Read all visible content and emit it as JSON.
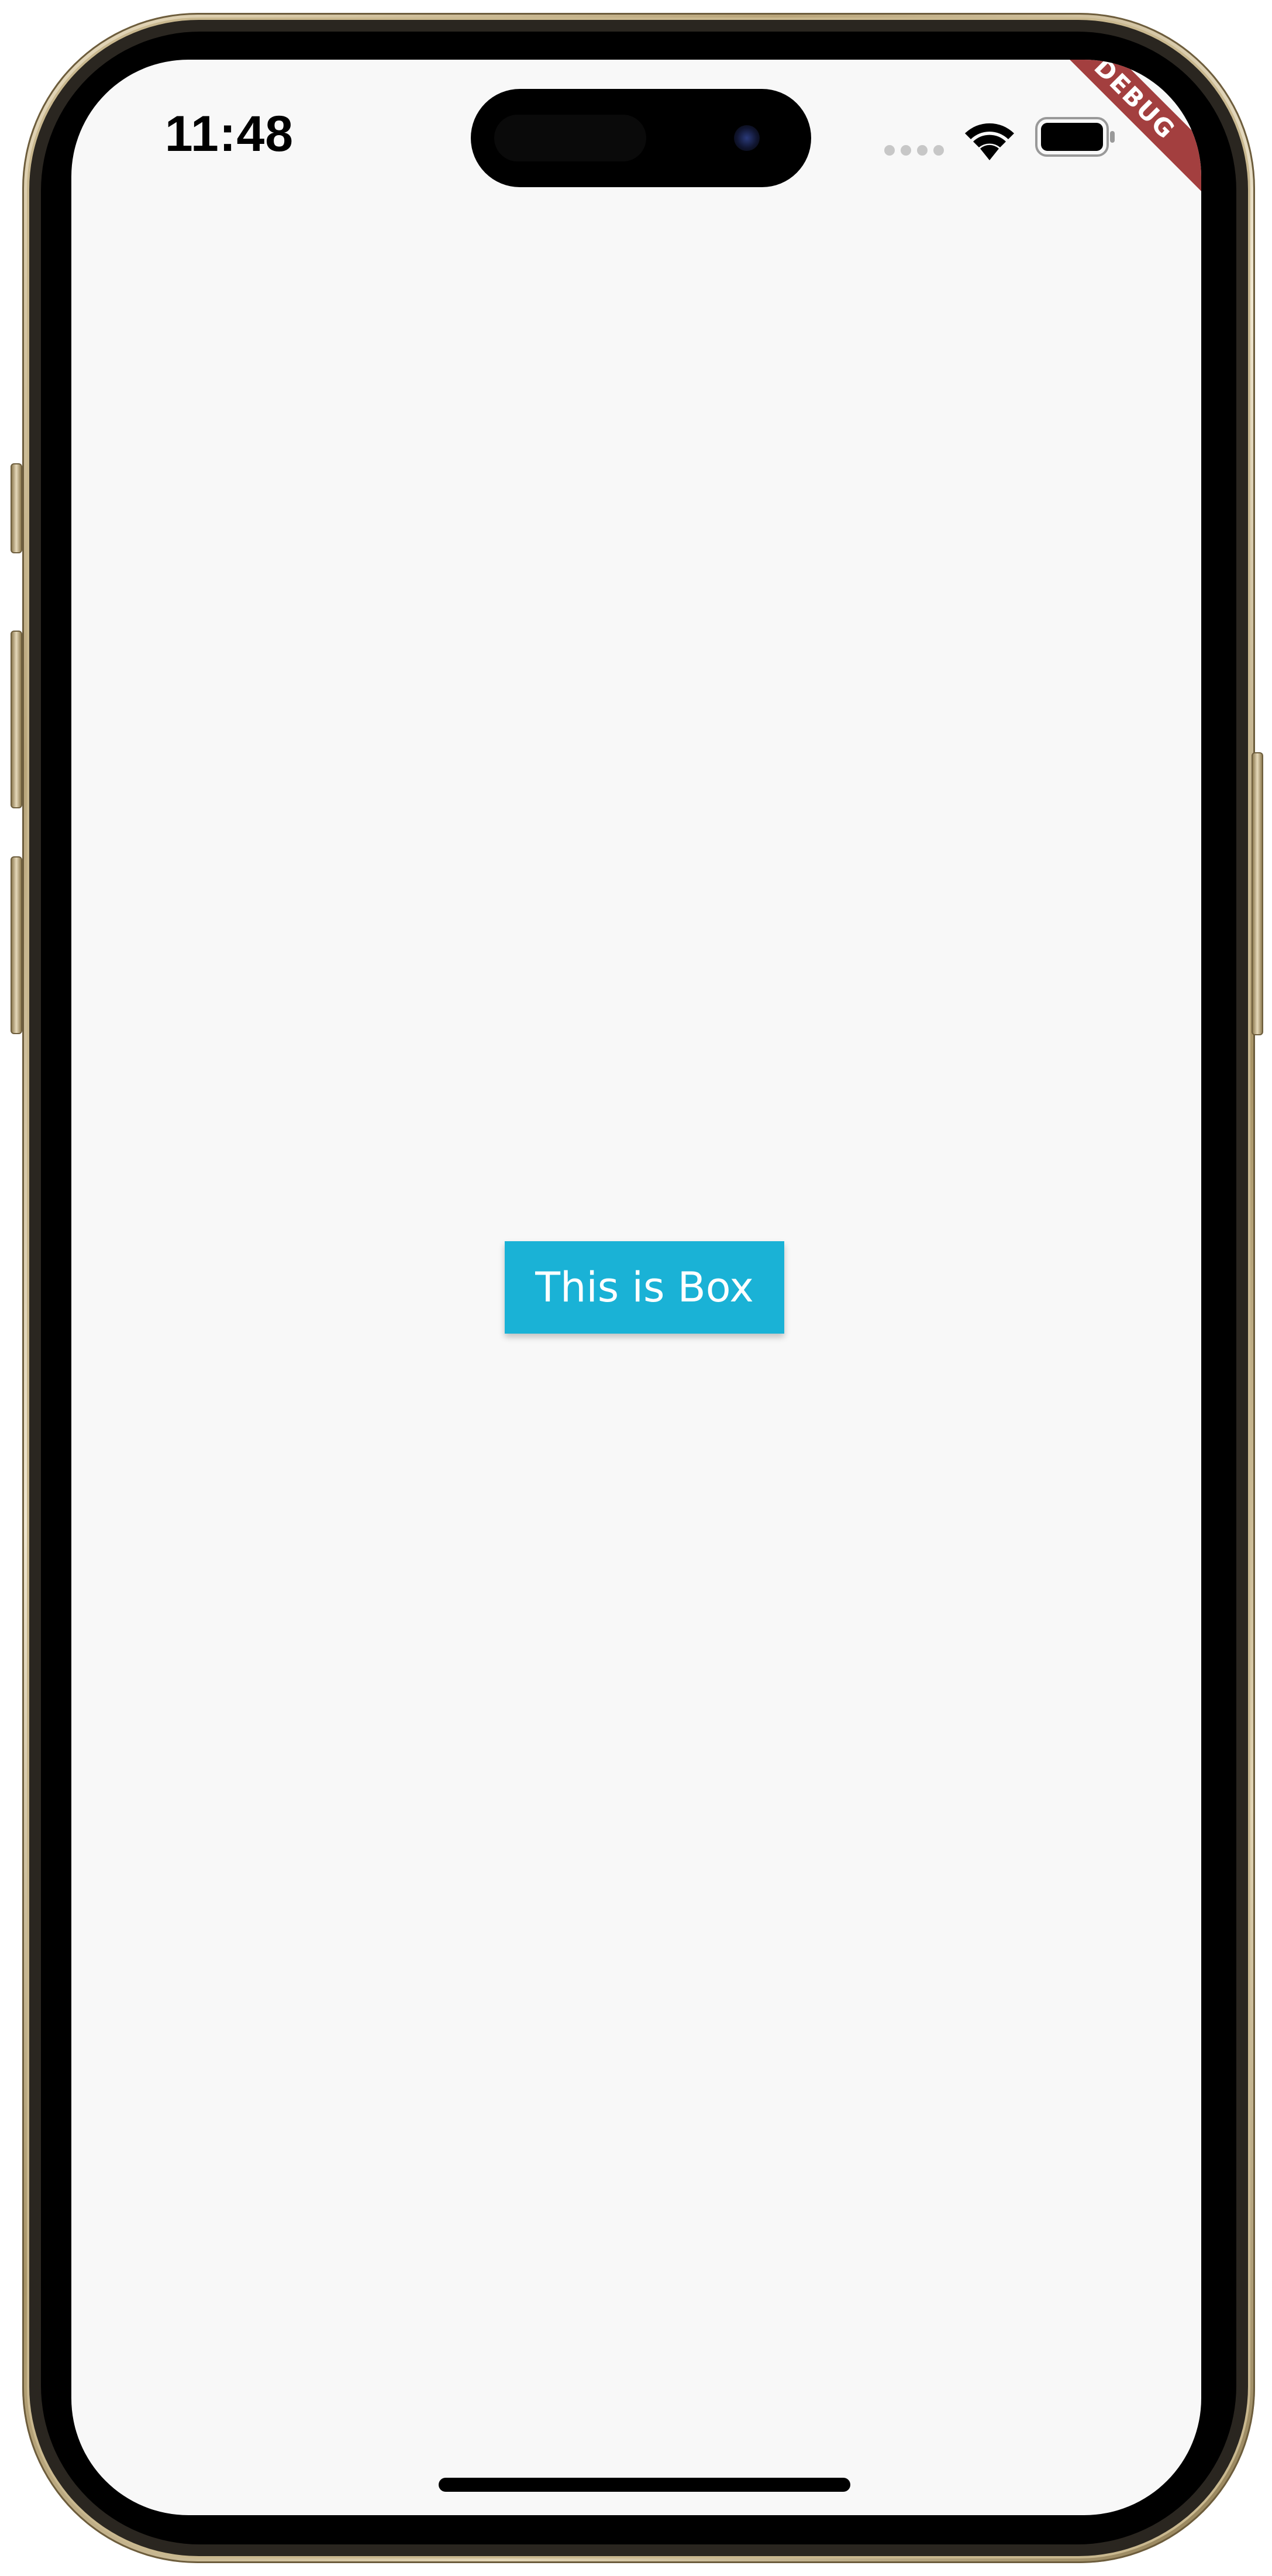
{
  "status_bar": {
    "time": "11:48",
    "wifi_icon": "wifi-icon",
    "battery_icon": "battery-icon",
    "signal_icon": "cellular-signal-dots-icon"
  },
  "debug_banner": {
    "label": "DEBUG",
    "color": "#a33f3f"
  },
  "main": {
    "box_label": "This is Box",
    "box_color": "#1ab2d6",
    "background_color": "#f8f8f8"
  }
}
